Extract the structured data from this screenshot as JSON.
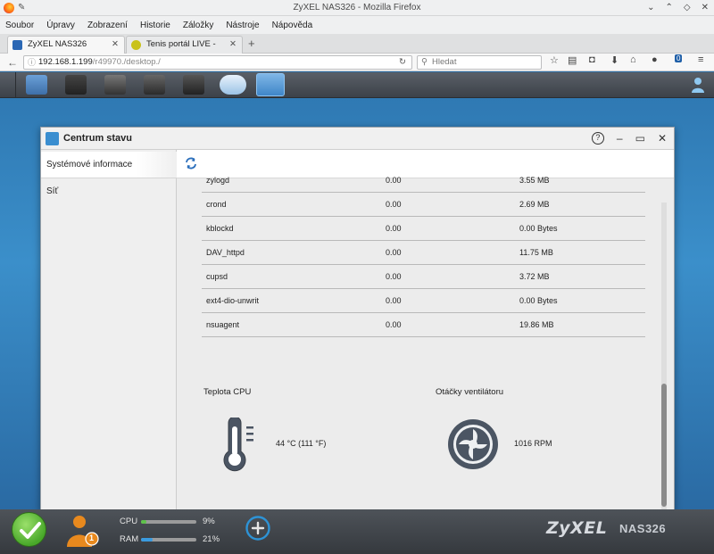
{
  "window": {
    "title": "ZyXEL NAS326 - Mozilla Firefox"
  },
  "menu": [
    "Soubor",
    "Úpravy",
    "Zobrazení",
    "Historie",
    "Záložky",
    "Nástroje",
    "Nápověda"
  ],
  "tabs": [
    {
      "label": "ZyXEL NAS326",
      "active": true
    },
    {
      "label": "Tenis portál LIVE - tenis...",
      "active": false
    }
  ],
  "navbar": {
    "url_host": "192.168.1.199",
    "url_path": "/r49970./desktop./",
    "search_placeholder": "Hledat",
    "badge": "0"
  },
  "app_window": {
    "title": "Centrum stavu",
    "help": "?"
  },
  "sidebar": {
    "items": [
      {
        "label": "Systémové informace",
        "selected": true
      },
      {
        "label": "Síť",
        "selected": false
      }
    ]
  },
  "processes": [
    {
      "name": "zylogd",
      "cpu": "0.00",
      "mem": "3.55 MB"
    },
    {
      "name": "crond",
      "cpu": "0.00",
      "mem": "2.69 MB"
    },
    {
      "name": "kblockd",
      "cpu": "0.00",
      "mem": "0.00 Bytes"
    },
    {
      "name": "DAV_httpd",
      "cpu": "0.00",
      "mem": "11.75 MB"
    },
    {
      "name": "cupsd",
      "cpu": "0.00",
      "mem": "3.72 MB"
    },
    {
      "name": "ext4-dio-unwrit",
      "cpu": "0.00",
      "mem": "0.00 Bytes"
    },
    {
      "name": "nsuagent",
      "cpu": "0.00",
      "mem": "19.86 MB"
    }
  ],
  "sensors": {
    "cpu_temp_label": "Teplota CPU",
    "cpu_temp_value": "44 °C (111 °F)",
    "fan_label": "Otáčky ventilátoru",
    "fan_value": "1016 RPM"
  },
  "statusbar": {
    "cpu_label": "CPU",
    "cpu_value": "9%",
    "cpu_fraction": 0.09,
    "ram_label": "RAM",
    "ram_value": "21%",
    "ram_fraction": 0.21,
    "notifications": "1",
    "brand": "ZyXEL",
    "model": "NAS326"
  },
  "colors": {
    "accent": "#2c6ea6",
    "ok_green": "#49a82a",
    "cpu_bar": "#5ec24a",
    "ram_bar": "#3a9be0",
    "badge_orange": "#e8891e"
  }
}
